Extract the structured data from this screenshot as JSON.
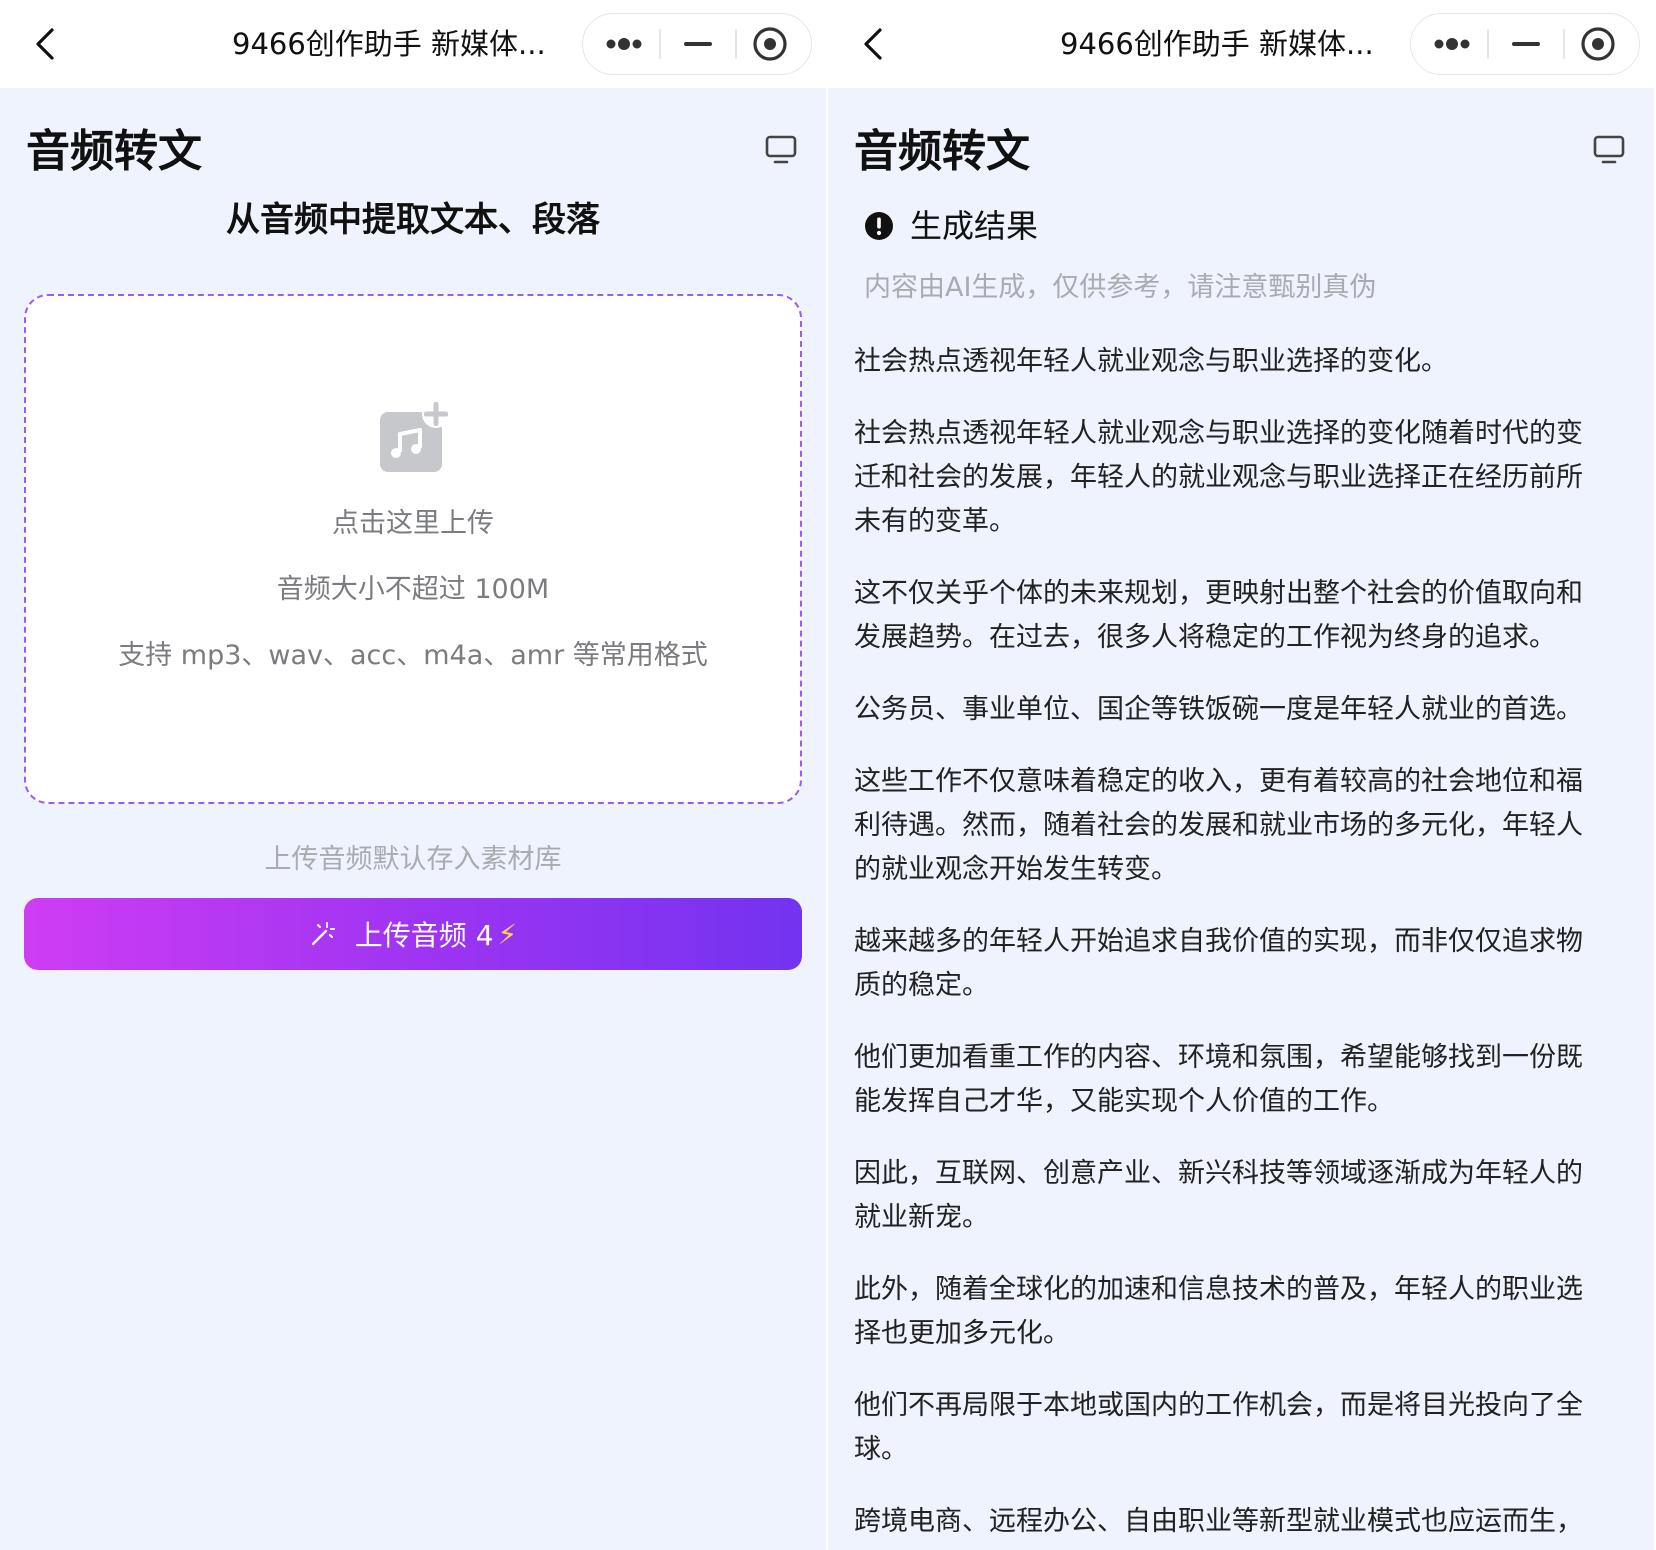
{
  "navbar": {
    "title": "9466创作助手 新媒体..."
  },
  "left": {
    "page_title": "音频转文",
    "subtitle": "从音频中提取文本、段落",
    "upload_box": {
      "line1": "点击这里上传",
      "line2": "音频大小不超过 100M",
      "line3": "支持 mp3、wav、acc、m4a、amr 等常用格式"
    },
    "storage_note": "上传音频默认存入素材库",
    "upload_button": {
      "label": "上传音频 4",
      "bolt": "⚡"
    }
  },
  "right": {
    "page_title": "音频转文",
    "result_title": "生成结果",
    "ai_note": "内容由AI生成，仅供参考，请注意甄别真伪",
    "paragraphs": [
      "社会热点透视年轻人就业观念与职业选择的变化。",
      "社会热点透视年轻人就业观念与职业选择的变化随着时代的变迁和社会的发展，年轻人的就业观念与职业选择正在经历前所未有的变革。",
      "这不仅关乎个体的未来规划，更映射出整个社会的价值取向和发展趋势。在过去，很多人将稳定的工作视为终身的追求。",
      "公务员、事业单位、国企等铁饭碗一度是年轻人就业的首选。",
      "这些工作不仅意味着稳定的收入，更有着较高的社会地位和福利待遇。然而，随着社会的发展和就业市场的多元化，年轻人的就业观念开始发生转变。",
      "越来越多的年轻人开始追求自我价值的实现，而非仅仅追求物质的稳定。",
      "他们更加看重工作的内容、环境和氛围，希望能够找到一份既能发挥自己才华，又能实现个人价值的工作。",
      "因此，互联网、创意产业、新兴科技等领域逐渐成为年轻人的就业新宠。",
      "此外，随着全球化的加速和信息技术的普及，年轻人的职业选择也更加多元化。",
      "他们不再局限于本地或国内的工作机会，而是将目光投向了全球。",
      "跨境电商、远程办公、自由职业等新型就业模式也应运而生，"
    ]
  }
}
